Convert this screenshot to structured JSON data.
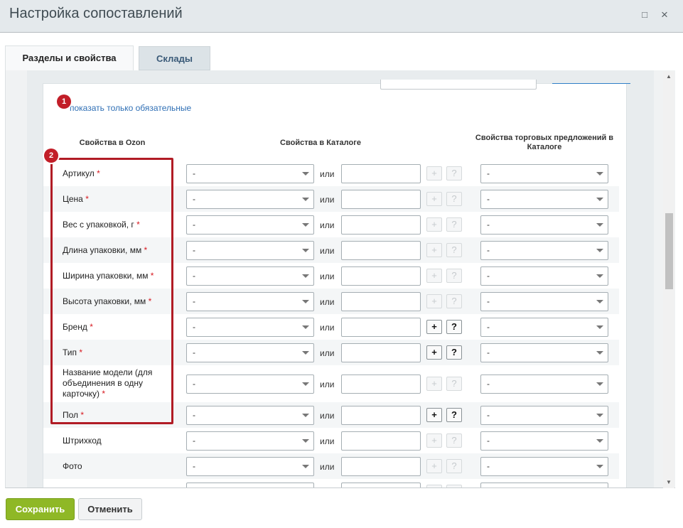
{
  "dialog": {
    "title": "Настройка сопоставлений",
    "close_symbol": "×",
    "maximize_symbol": "□"
  },
  "tabs": [
    {
      "label": "Разделы и свойства",
      "active": true
    },
    {
      "label": "Склады",
      "active": false
    }
  ],
  "filter_link": "показать только обязательные",
  "badges": [
    "1",
    "2"
  ],
  "columns": {
    "ozon": "Свойства в Ozon",
    "catalog": "Свойства в Каталоге",
    "offers": "Свойства торговых предложений в Каталоге"
  },
  "or_label": "или",
  "plus": "+",
  "question": "?",
  "required_mark": "*",
  "rows": [
    {
      "label": "Артикул",
      "required": true,
      "select": "-",
      "offer_select": "-",
      "buttons_enabled": false
    },
    {
      "label": "Цена",
      "required": true,
      "select": "-",
      "offer_select": "-",
      "buttons_enabled": false
    },
    {
      "label": "Вес с упаковкой, г",
      "required": true,
      "select": "-",
      "offer_select": "-",
      "buttons_enabled": false
    },
    {
      "label": "Длина упаковки, мм",
      "required": true,
      "select": "-",
      "offer_select": "-",
      "buttons_enabled": false
    },
    {
      "label": "Ширина упаковки, мм",
      "required": true,
      "select": "-",
      "offer_select": "-",
      "buttons_enabled": false
    },
    {
      "label": "Высота упаковки, мм",
      "required": true,
      "select": "-",
      "offer_select": "-",
      "buttons_enabled": false
    },
    {
      "label": "Бренд",
      "required": true,
      "select": "-",
      "offer_select": "-",
      "buttons_enabled": true
    },
    {
      "label": "Тип",
      "required": true,
      "select": "-",
      "offer_select": "-",
      "buttons_enabled": true
    },
    {
      "label": "Название модели (для объединения в одну карточку)",
      "required": true,
      "select": "-",
      "offer_select": "-",
      "buttons_enabled": false
    },
    {
      "label": "Пол",
      "required": true,
      "select": "-",
      "offer_select": "-",
      "buttons_enabled": true
    },
    {
      "label": "Штрихкод",
      "required": false,
      "select": "-",
      "offer_select": "-",
      "buttons_enabled": false
    },
    {
      "label": "Фото",
      "required": false,
      "select": "-",
      "offer_select": "-",
      "buttons_enabled": false
    },
    {
      "label": "",
      "required": false,
      "select": "",
      "offer_select": "",
      "buttons_enabled": false
    }
  ],
  "footer": {
    "save": "Сохранить",
    "cancel": "Отменить"
  },
  "colors": {
    "accent_green": "#8fb826",
    "badge_red": "#c21e28",
    "required_star": "#d71920",
    "link_blue": "#2f6fb5"
  }
}
